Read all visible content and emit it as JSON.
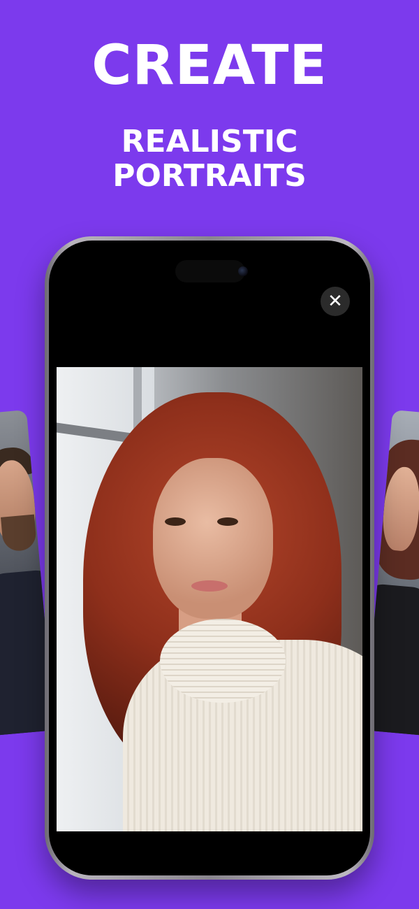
{
  "headline": {
    "title": "CREATE",
    "subtitle_line1": "REALISTIC",
    "subtitle_line2": "PORTRAITS"
  },
  "colors": {
    "background": "#7c3aed",
    "text": "#ffffff"
  },
  "icons": {
    "close": "close-icon"
  },
  "close_button": {
    "glyph": "✕"
  }
}
